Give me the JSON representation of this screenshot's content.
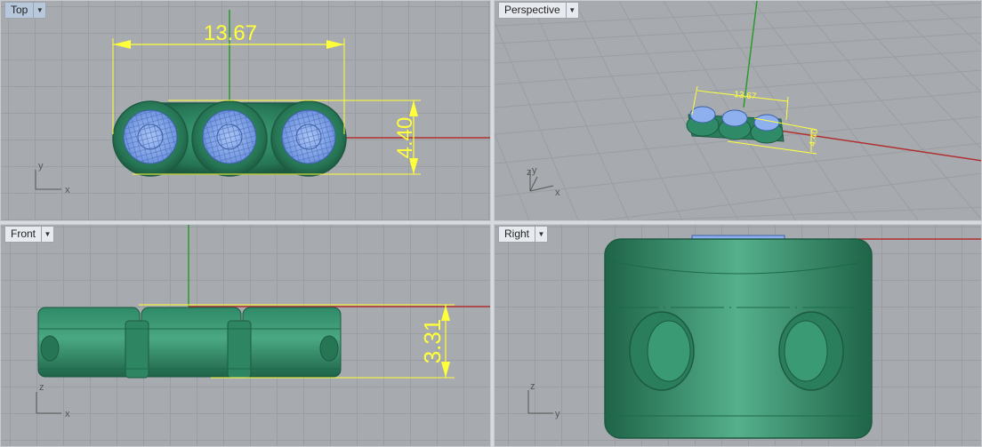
{
  "viewports": {
    "top": {
      "title": "Top",
      "dimension_width": "13.67",
      "dimension_height": "4.40",
      "axis_x": "x",
      "axis_y": "y"
    },
    "perspective": {
      "title": "Perspective",
      "dimension_width": "13.67",
      "dimension_height": "4.40",
      "axis_x": "x",
      "axis_y": "y",
      "axis_z": "z"
    },
    "front": {
      "title": "Front",
      "dimension_height": "3.31",
      "axis_x": "x",
      "axis_z": "z"
    },
    "right": {
      "title": "Right",
      "axis_y": "y",
      "axis_z": "z"
    }
  },
  "menu_arrow": "▼",
  "colors": {
    "viewport_bg": "#a7abb0",
    "grid": "#9a9ea3",
    "dimension": "#ffff3a",
    "model_green": "#2f8a67",
    "gem_blue": "#8fb0ef",
    "x_axis": "#b03030",
    "y_axis": "#2a9a2a"
  }
}
